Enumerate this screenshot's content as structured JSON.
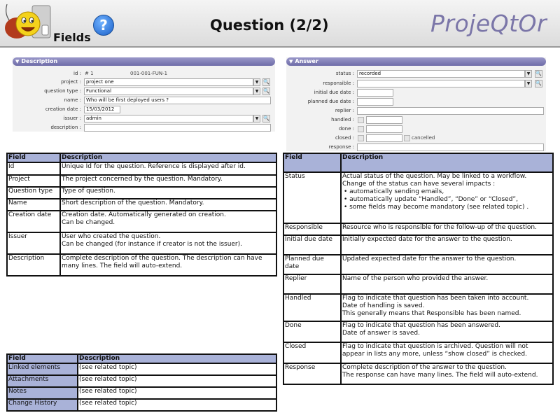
{
  "header": {
    "fields_label": "Fields",
    "help_icon": "question-mark-icon",
    "title": "Question (2/2)",
    "brand": "ProjeQtOr"
  },
  "description_panel": {
    "title": "Description",
    "id_label": "id :",
    "id_value": "# 1",
    "reference": "001-001-FUN-1",
    "project_label": "project :",
    "project_value": "project one",
    "question_type_label": "question type :",
    "question_type_value": "Functional",
    "name_label": "name :",
    "name_value": "Who will be first deployed users ?",
    "creation_date_label": "creation date :",
    "creation_date_value": "15/03/2012",
    "issuer_label": "issuer :",
    "issuer_value": "admin",
    "description_label": "description :",
    "description_value": ""
  },
  "answer_panel": {
    "title": "Answer",
    "status_label": "status :",
    "status_value": "recorded",
    "responsible_label": "responsible :",
    "responsible_value": "",
    "initial_due_date_label": "initial due date :",
    "planned_due_date_label": "planned due date :",
    "replier_label": "replier :",
    "handled_label": "handled :",
    "done_label": "done :",
    "closed_label": "closed :",
    "cancelled_label": "cancelled",
    "response_label": "response :"
  },
  "table_main": {
    "headers": [
      "Field",
      "Description"
    ],
    "rows": [
      {
        "field": "Id",
        "desc": [
          "Unique Id for the question. Reference is displayed after id."
        ]
      },
      {
        "field": "Project",
        "desc": [
          "The project concerned by the question. Mandatory."
        ]
      },
      {
        "field": "Question type",
        "desc": [
          "Type of question."
        ]
      },
      {
        "field": "Name",
        "desc": [
          "Short description of the question. Mandatory."
        ]
      },
      {
        "field": "Creation date",
        "desc": [
          "Creation date. Automatically generated on creation.",
          "Can be changed."
        ]
      },
      {
        "field": "Issuer",
        "desc": [
          "User who created the question.",
          "Can be changed (for instance if creator is not the issuer)."
        ]
      },
      {
        "field": "Description",
        "desc": [
          "Complete description of the question. The description can have many lines. The field will auto-extend."
        ]
      }
    ]
  },
  "table_sections": {
    "headers": [
      "Field",
      "Description"
    ],
    "rows": [
      {
        "field": "Linked elements",
        "desc": "(see related topic)"
      },
      {
        "field": "Attachments",
        "desc": "(see related topic)"
      },
      {
        "field": "Notes",
        "desc": "(see related topic)"
      },
      {
        "field": "Change History",
        "desc": "(see related topic)"
      }
    ]
  },
  "table_answer": {
    "headers": [
      "Field",
      "Description"
    ],
    "rows": [
      {
        "field": "Status",
        "desc": [
          "Actual status of the question. May be linked to a workflow.",
          "Change of the status can have several impacts :",
          "• automatically sending emails,",
          "• automatically update “Handled”, “Done” or “Closed”,",
          "• some fields may become mandatory (see related topic) ."
        ]
      },
      {
        "field": "Responsible",
        "desc": [
          "Resource who is responsible for the follow-up of the question."
        ]
      },
      {
        "field": "Initial due date",
        "desc": [
          "Initially expected date for the answer to the question."
        ]
      },
      {
        "field": "Planned due date",
        "desc": [
          "Updated expected date for the answer to the question."
        ]
      },
      {
        "field": "Replier",
        "desc": [
          "Name of the person who provided the answer."
        ]
      },
      {
        "field": "Handled",
        "desc": [
          "Flag to indicate that question has been taken into account.",
          "Date of handling is saved.",
          "This generally means that Responsible has been named."
        ]
      },
      {
        "field": "Done",
        "desc": [
          "Flag to indicate that question has been answered.",
          "Date of answer is saved."
        ]
      },
      {
        "field": "Closed",
        "desc": [
          "Flag to indicate that question is archived. Question will not appear in lists any more, unless “show closed” is checked."
        ]
      },
      {
        "field": "Response",
        "desc": [
          "Complete description of the answer to the question.",
          "The response can have many lines. The field will auto-extend."
        ]
      }
    ]
  }
}
